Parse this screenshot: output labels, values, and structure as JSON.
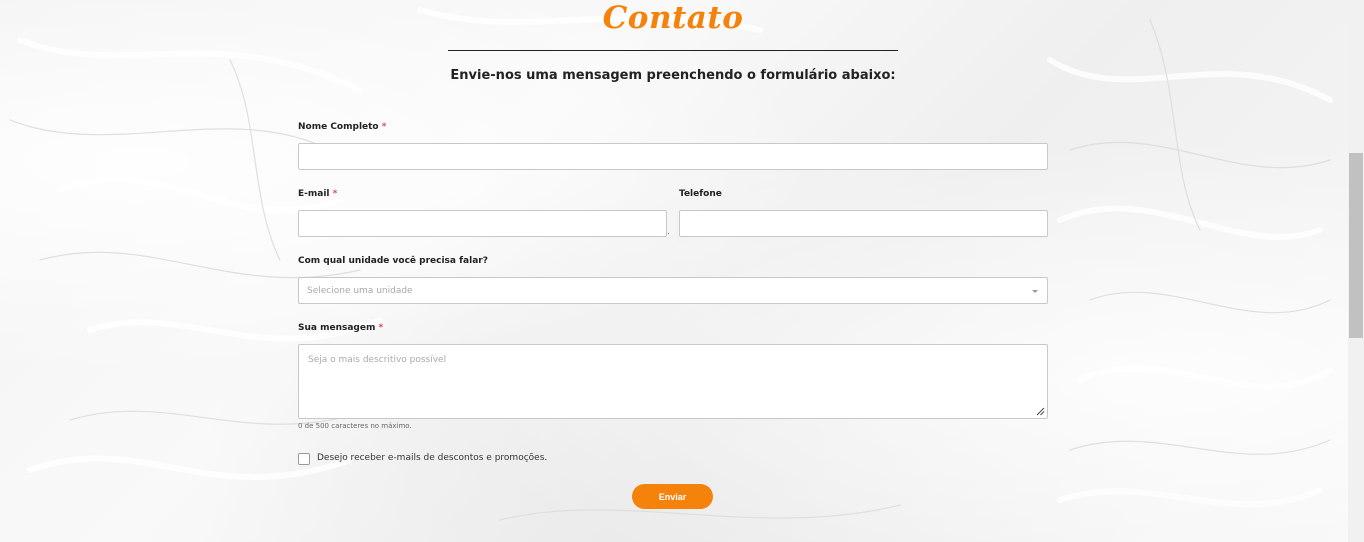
{
  "header": {
    "title": "Contato",
    "subtitle": "Envie-nos uma mensagem preenchendo o formulário abaixo:"
  },
  "form": {
    "name_label": "Nome Completo",
    "email_label": "E-mail",
    "phone_label": "Telefone",
    "required_mark": "*",
    "phone_separator": ".",
    "unit_label": "Com qual unidade você precisa falar?",
    "unit_placeholder": "Selecione uma unidade",
    "message_label": "Sua mensagem",
    "message_placeholder": "Seja o mais descritivo possível",
    "message_counter": "0 de 500 caracteres no máximo.",
    "optin_label": "Desejo receber e-mails de descontos e promoções.",
    "submit_label": "Enviar"
  },
  "colors": {
    "accent": "#f5820a",
    "required": "#e04a4a"
  },
  "icons": {
    "select_arrow": "caret-down-icon",
    "textarea_resize": "resize-handle-icon"
  }
}
